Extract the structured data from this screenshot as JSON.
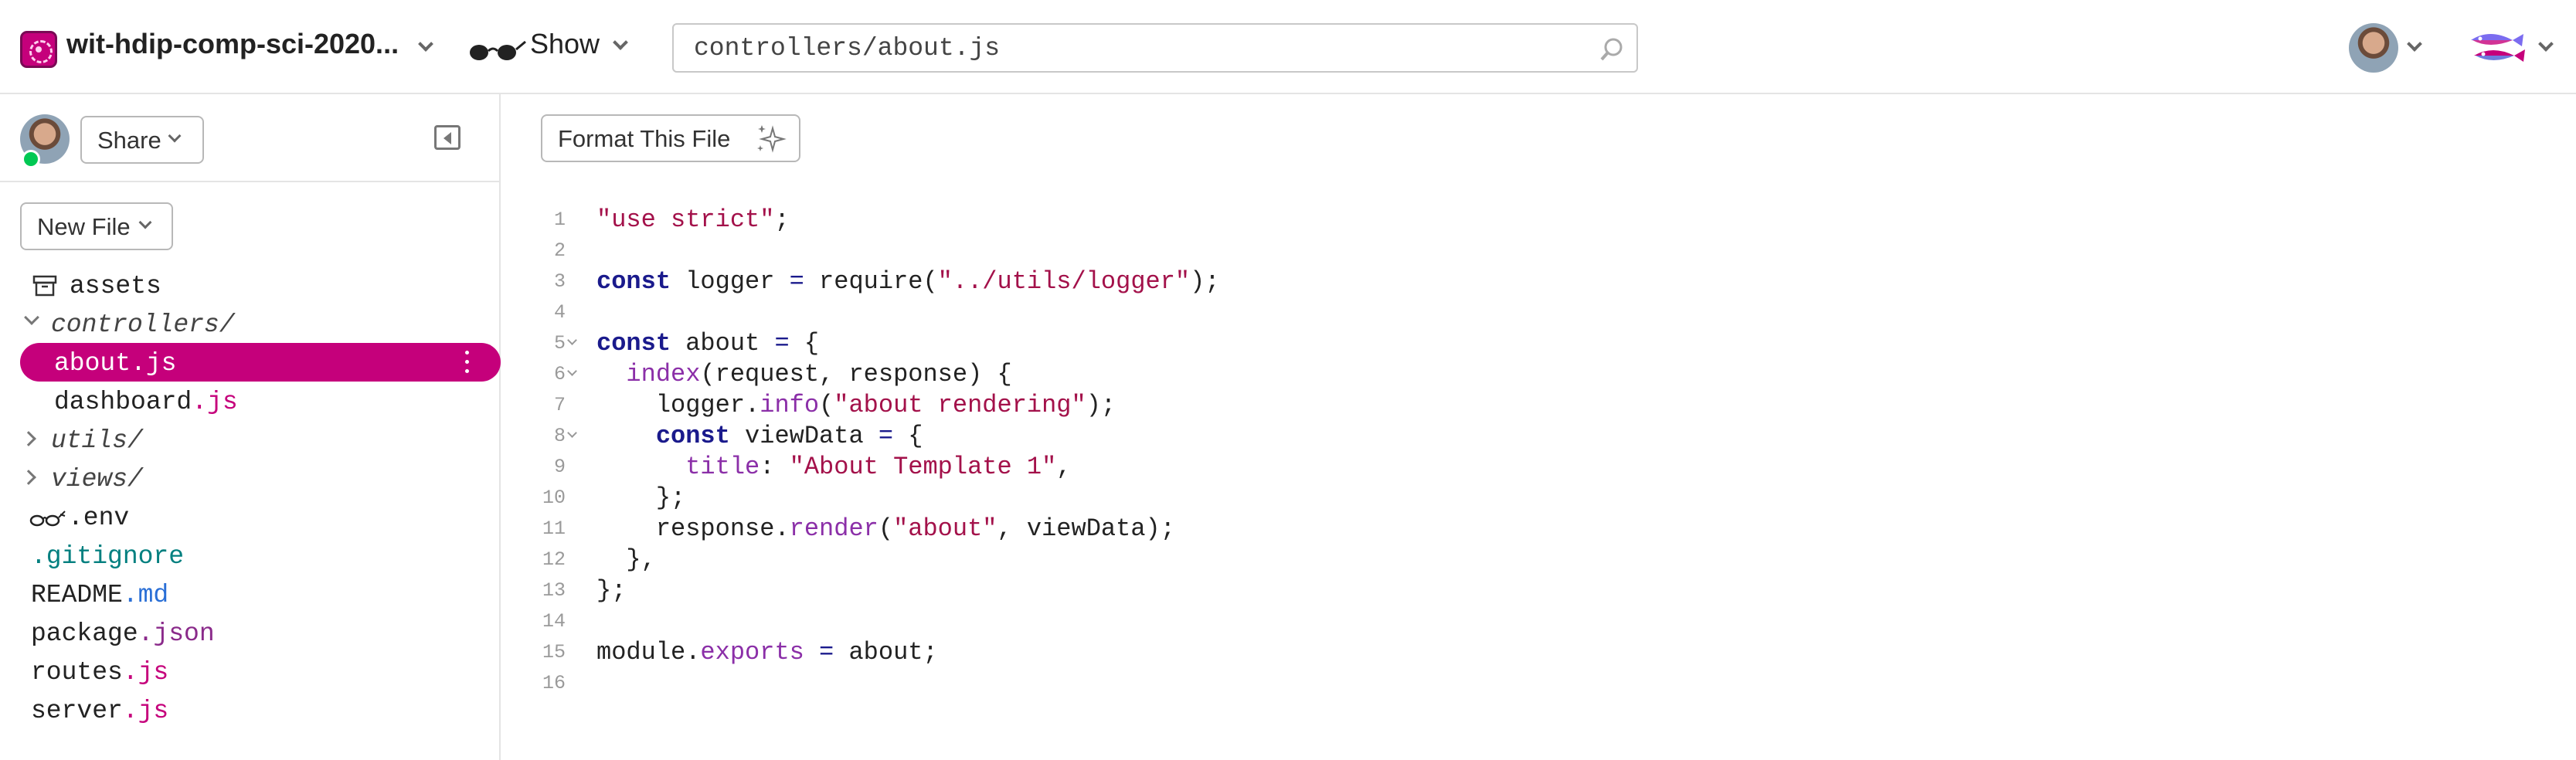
{
  "topbar": {
    "project_name": "wit-hdip-comp-sci-2020...",
    "show_label": "Show",
    "search_value": "controllers/about.js"
  },
  "sidebar": {
    "share_label": "Share",
    "new_file_label": "New File",
    "tree": [
      {
        "label": "assets",
        "type": "assets"
      },
      {
        "label": "controllers/",
        "type": "folder-open"
      },
      {
        "label": "about",
        "ext": ".js",
        "type": "file",
        "selected": true
      },
      {
        "label": "dashboard",
        "ext": ".js",
        "type": "file"
      },
      {
        "label": "utils/",
        "type": "folder-closed"
      },
      {
        "label": "views/",
        "type": "folder-closed"
      },
      {
        "label": ".env",
        "type": "env"
      },
      {
        "label": ".gitignore",
        "type": "file"
      },
      {
        "label": "README",
        "ext": ".md",
        "type": "file"
      },
      {
        "label": "package",
        "ext": ".json",
        "type": "file"
      },
      {
        "label": "routes",
        "ext": ".js",
        "type": "file"
      },
      {
        "label": "server",
        "ext": ".js",
        "type": "file"
      }
    ]
  },
  "editor": {
    "format_label": "Format This File",
    "lines": [
      {
        "n": "1",
        "fold": false,
        "code": "\"use strict\";"
      },
      {
        "n": "2",
        "fold": false,
        "code": ""
      },
      {
        "n": "3",
        "fold": false,
        "code": "const logger = require(\"../utils/logger\");"
      },
      {
        "n": "4",
        "fold": false,
        "code": ""
      },
      {
        "n": "5",
        "fold": true,
        "code": "const about = {"
      },
      {
        "n": "6",
        "fold": true,
        "code": "  index(request, response) {"
      },
      {
        "n": "7",
        "fold": false,
        "code": "    logger.info(\"about rendering\");"
      },
      {
        "n": "8",
        "fold": true,
        "code": "    const viewData = {"
      },
      {
        "n": "9",
        "fold": false,
        "code": "      title: \"About Template 1\","
      },
      {
        "n": "10",
        "fold": false,
        "code": "    };"
      },
      {
        "n": "11",
        "fold": false,
        "code": "    response.render(\"about\", viewData);"
      },
      {
        "n": "12",
        "fold": false,
        "code": "  },"
      },
      {
        "n": "13",
        "fold": false,
        "code": "};"
      },
      {
        "n": "14",
        "fold": false,
        "code": ""
      },
      {
        "n": "15",
        "fold": false,
        "code": "module.exports = about;"
      },
      {
        "n": "16",
        "fold": false,
        "code": ""
      }
    ]
  },
  "colors": {
    "accent": "#c5007b",
    "online": "#00c853",
    "string": "#a3114a",
    "keyword": "#1a1a8c",
    "property": "#8b2fa8"
  }
}
